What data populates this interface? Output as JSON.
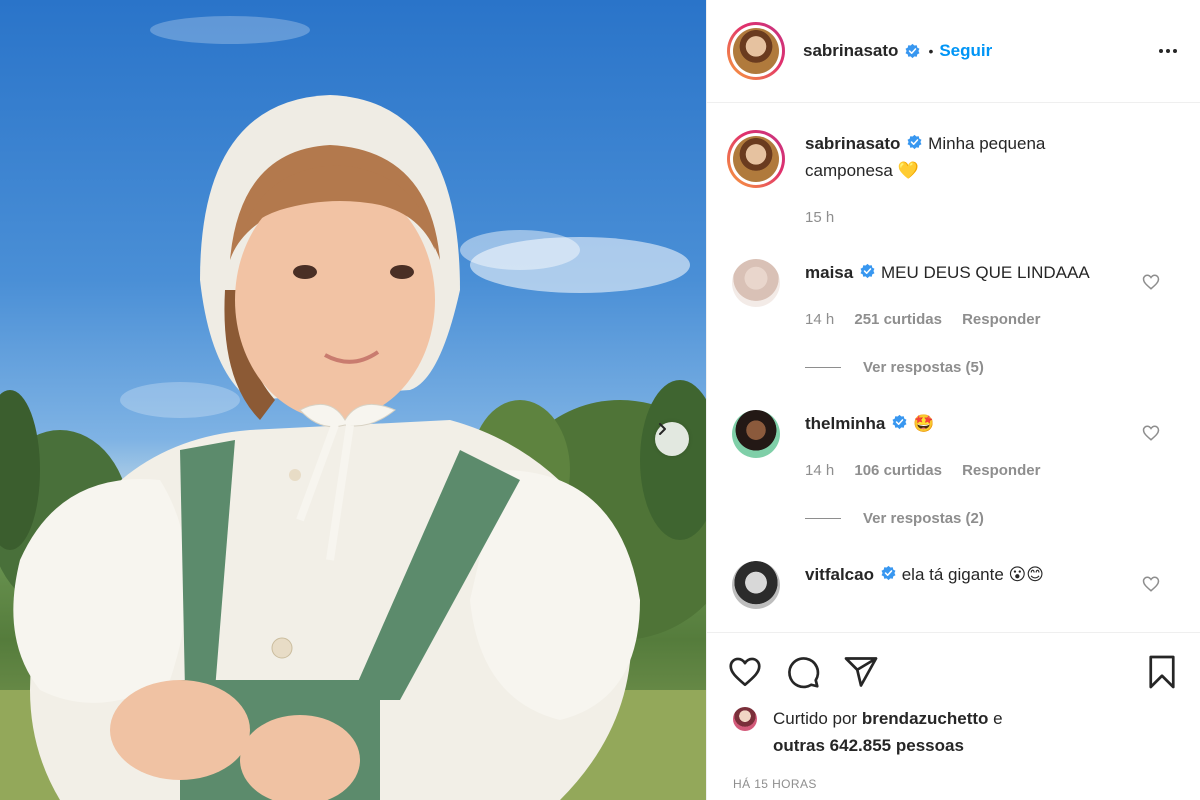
{
  "post": {
    "username": "sabrinasato",
    "follow_label": "Seguir",
    "separator": "•",
    "caption_text": "Minha pequena camponesa",
    "caption_emoji": "💛",
    "caption_time": "15 h"
  },
  "comments": [
    {
      "username": "maisa",
      "text": "MEU DEUS QUE LINDAAA",
      "time": "14 h",
      "likes": "251 curtidas",
      "reply_label": "Responder",
      "view_replies": "Ver respostas (5)"
    },
    {
      "username": "thelminha",
      "text": "🤩",
      "time": "14 h",
      "likes": "106 curtidas",
      "reply_label": "Responder",
      "view_replies": "Ver respostas (2)"
    },
    {
      "username": "vitfalcao",
      "text": "ela tá gigante 😮😊"
    }
  ],
  "footer": {
    "liked_prefix": "Curtido por",
    "liked_user": "brendazuchetto",
    "liked_and": "e",
    "liked_others": "outras 642.855 pessoas",
    "time_ago": "HÁ 15 HORAS"
  },
  "icons": {
    "verified": "verified-badge-icon",
    "like": "heart-icon",
    "comment": "comment-bubble-icon",
    "share": "paper-plane-icon",
    "save": "bookmark-icon",
    "more": "more-dots-icon",
    "carousel_next": "chevron-right-icon"
  },
  "colors": {
    "accent": "#0095f6",
    "verified": "#3897f0",
    "muted": "#8e8e8e",
    "text": "#262626"
  }
}
